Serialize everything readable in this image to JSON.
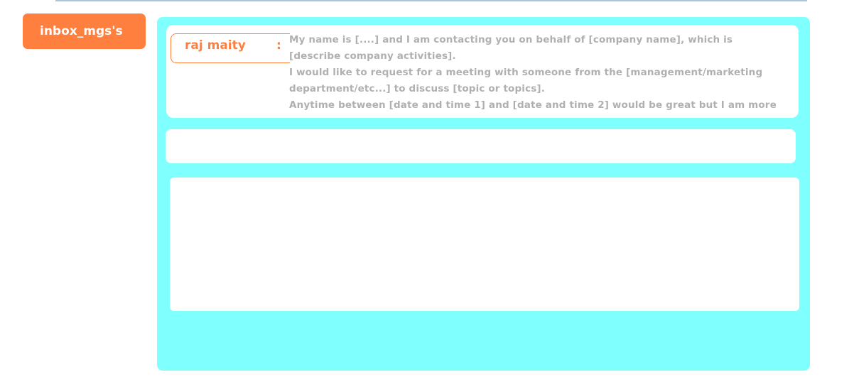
{
  "sidebar": {
    "inbox_label": "inbox_mgs's"
  },
  "message": {
    "sender": "raj maity",
    "separator": ":",
    "lines": [
      "My name is [....] and I am contacting you on behalf of [company name], which is",
      "[describe company activities].",
      "I would like to request for a meeting with someone from the [management/marketing",
      "department/etc...] to discuss [topic or topics].",
      "Anytime between [date and time 1] and [date and time 2] would be great but I am more"
    ]
  },
  "colors": {
    "accent": "#ff7f3f",
    "panel": "#80ffff",
    "muted_text": "#b0b0b0"
  }
}
